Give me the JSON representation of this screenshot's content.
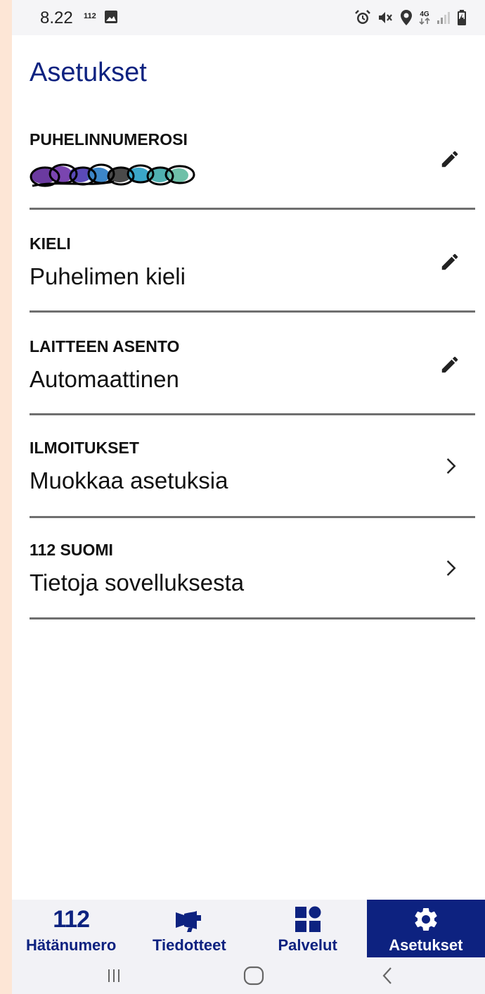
{
  "status_bar": {
    "time": "8.22",
    "badge": "112",
    "icons": [
      "image-icon",
      "alarm-icon",
      "mute-icon",
      "location-icon",
      "4g-icon",
      "signal-icon",
      "battery-icon"
    ],
    "network_label": "4G"
  },
  "page": {
    "title": "Asetukset"
  },
  "settings": [
    {
      "label": "PUHELINNUMEROSI",
      "value": "",
      "action_icon": "edit-icon",
      "value_redacted": true
    },
    {
      "label": "KIELI",
      "value": "Puhelimen kieli",
      "action_icon": "edit-icon"
    },
    {
      "label": "LAITTEEN ASENTO",
      "value": "Automaattinen",
      "action_icon": "edit-icon"
    },
    {
      "label": "ILMOITUKSET",
      "value": "Muokkaa asetuksia",
      "action_icon": "chevron-right-icon"
    },
    {
      "label": "112 SUOMI",
      "value": "Tietoja sovelluksesta",
      "action_icon": "chevron-right-icon"
    }
  ],
  "bottom_nav": {
    "items": [
      {
        "icon_text": "112",
        "label": "Hätänumero",
        "icon": "emergency-number-icon",
        "active": false
      },
      {
        "label": "Tiedotteet",
        "icon": "megaphone-icon",
        "active": false
      },
      {
        "label": "Palvelut",
        "icon": "services-grid-icon",
        "active": false
      },
      {
        "label": "Asetukset",
        "icon": "gear-icon",
        "active": true
      }
    ]
  },
  "system_nav": {
    "buttons": [
      "recent-apps-icon",
      "home-icon",
      "back-icon"
    ]
  },
  "colors": {
    "brand_navy": "#0d2280",
    "divider": "#6f6f6f",
    "nav_background": "#f2f2f6",
    "left_strip": "#fde6d6"
  }
}
